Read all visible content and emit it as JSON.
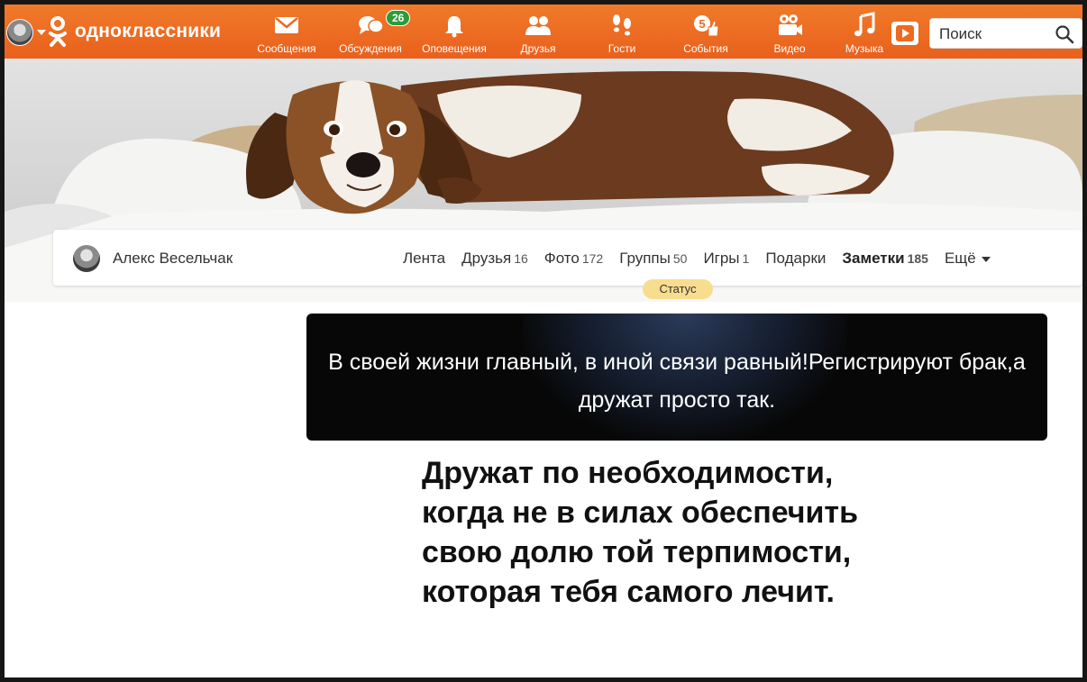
{
  "app": {
    "logo_text": "одноклассники"
  },
  "nav": {
    "messages": "Сообщения",
    "discussions": "Обсуждения",
    "discussions_badge": "26",
    "notifications": "Оповещения",
    "friends": "Друзья",
    "guests": "Гости",
    "events": "События",
    "video": "Видео",
    "music": "Музыка"
  },
  "search": {
    "placeholder": "Поиск"
  },
  "profile": {
    "name": "Алекс Весельчак",
    "tabs": [
      {
        "label": "Лента",
        "count": ""
      },
      {
        "label": "Друзья",
        "count": "16"
      },
      {
        "label": "Фото",
        "count": "172"
      },
      {
        "label": "Группы",
        "count": "50"
      },
      {
        "label": "Игры",
        "count": "1"
      },
      {
        "label": "Подарки",
        "count": ""
      },
      {
        "label": "Заметки",
        "count": "185"
      },
      {
        "label": "Ещё",
        "count": ""
      }
    ],
    "status_label": "Статус"
  },
  "status": {
    "text": "В своей жизни главный, в иной связи равный!Регистрируют брак,а дружат просто так."
  },
  "poem": {
    "lines": [
      "Дружат по необходимости,",
      "когда не в силах обеспечить",
      "свою долю той терпимости,",
      "которая тебя самого лечит."
    ]
  },
  "colors": {
    "topbar": "#ee6a20",
    "badge": "#2c9b38",
    "status_pill": "#f8dd8f",
    "status_card": "#070707"
  },
  "icons": {
    "messages": "envelope-icon",
    "discussions": "speech-bubbles-icon",
    "notifications": "bell-icon",
    "friends": "people-icon",
    "guests": "footprints-icon",
    "events": "coin-thumbs-up-icon",
    "video": "video-camera-icon",
    "music": "music-note-icon",
    "search": "magnifier-icon"
  }
}
